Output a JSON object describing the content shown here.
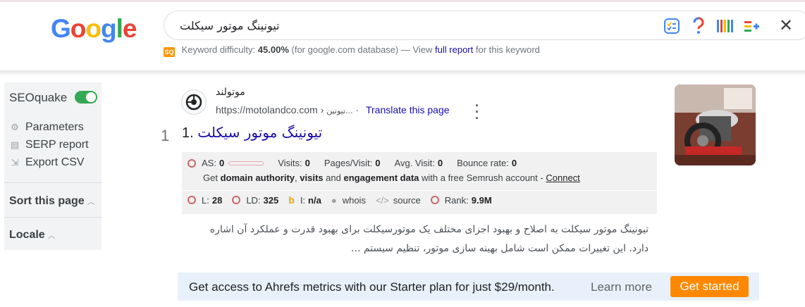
{
  "google_logo": "Google",
  "search": {
    "query": "تیونینگ موتور سیکلت",
    "icons": [
      "keep-icon",
      "question-icon",
      "extension-icon",
      "extension-plus-icon",
      "close-icon"
    ]
  },
  "keyword_difficulty": {
    "badge": "SQ",
    "label": "Keyword difficulty:",
    "value": "45.00%",
    "database": "(for google.com database) — View",
    "link": "full report",
    "suffix": "for this keyword"
  },
  "sidebar": {
    "title": "SEOquake",
    "toggle_on": true,
    "items": [
      {
        "label": "Parameters",
        "icon": "gear-icon"
      },
      {
        "label": "SERP report",
        "icon": "report-icon"
      },
      {
        "label": "Export CSV",
        "icon": "export-icon"
      }
    ],
    "sort": "Sort this page",
    "locale": "Locale"
  },
  "result": {
    "site_name": "موتولند",
    "url": "https://motolandco.com ›",
    "breadcrumb": "تیونین...",
    "translate": "Translate this page",
    "rank": "1",
    "number": "1.",
    "title": "تیونینگ موتور سیکلت",
    "seo": {
      "as_label": "AS:",
      "as_value": "0",
      "visits_label": "Visits:",
      "visits_value": "0",
      "pages_label": "Pages/Visit:",
      "pages_value": "0",
      "avg_label": "Avg. Visit:",
      "avg_value": "0",
      "bounce_label": "Bounce rate:",
      "bounce_value": "0",
      "promo_get": "Get",
      "promo_domain": "domain authority",
      "promo_visits": "visits",
      "promo_and": "and",
      "promo_engagement": "engagement data",
      "promo_rest": "with a free Semrush account -",
      "connect": "Connect",
      "l_label": "L:",
      "l_value": "28",
      "ld_label": "LD:",
      "ld_value": "325",
      "i_label": "I:",
      "i_value": "n/a",
      "whois": "whois",
      "source": "source",
      "rank_label": "Rank:",
      "rank_value": "9.9M"
    },
    "snippet_line1": "تیونینگ موتور سیکلت به اصلاح و بهبود اجزای مختلف یک موتورسیکلت برای بهبود قدرت و عملکرد آن اشاره",
    "snippet_line2": "دارد. این تغییرات ممکن است شامل بهینه سازی موتور، تنظیم سیستم ..."
  },
  "ahrefs": {
    "text": "Get access to Ahrefs metrics with our Starter plan for just $29/month.",
    "learn_more": "Learn more",
    "cta": "Get started"
  },
  "colors": {
    "link": "#1a0dab",
    "toggle": "#34a853",
    "cta": "#ff8800",
    "banner": "#e8f1fb"
  }
}
